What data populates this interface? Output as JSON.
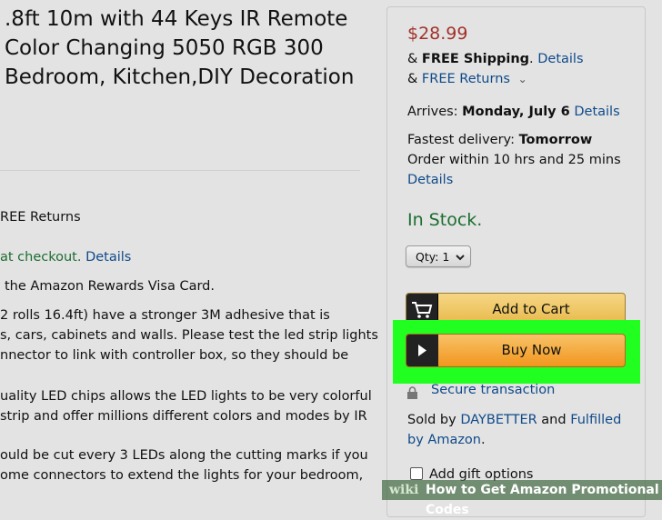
{
  "product": {
    "title_lines": [
      ".8ft 10m with 44 Keys IR Remote",
      "Color Changing 5050 RGB 300",
      "Bedroom, Kitchen,DIY Decoration"
    ],
    "free_returns": "REE Returns",
    "checkout_prefix": "at checkout.",
    "checkout_link": "Details",
    "rewards_link": "the Amazon Rewards Visa Card.",
    "description_lines": [
      "2 rolls 16.4ft) have a stronger 3M adhesive that is",
      "s, cars, cabinets and walls. Please test the led strip lights",
      "nnector to link with controller box, so they should be",
      "uality LED chips allows the LED lights to be very colorful",
      "strip and offer millions different colors and modes by IR",
      "ould be cut every 3 LEDs along the cutting marks if you",
      "ome connectors to extend the lights for your bedroom,"
    ]
  },
  "buybox": {
    "price": "$28.99",
    "shipping_prefix": "& ",
    "shipping_bold": "FREE Shipping",
    "shipping_suffix": ".",
    "shipping_link": "Details",
    "returns_prefix": "& ",
    "returns_link": "FREE Returns",
    "returns_chevron": "⌄",
    "arrives_label": "Arrives: ",
    "arrives_date": "Monday, July 6",
    "arrives_link": "Details",
    "fastest_label": "Fastest delivery: ",
    "fastest_value": "Tomorrow",
    "order_within": "Order within 10 hrs and 25 mins",
    "fastest_link": "Details",
    "stock": "In Stock.",
    "qty_label": "Qty: 1",
    "add_to_cart": "Add to Cart",
    "buy_now": "Buy Now",
    "secure": "Secure transaction",
    "sold_by_prefix": "Sold by ",
    "seller_link": "DAYBETTER",
    "and_text": " and ",
    "fulfilled_link": "Fulfilled",
    "by_amazon_link": "by Amazon",
    "by_amazon_suffix": ".",
    "gift_label": "Add gift options"
  },
  "watermark": {
    "wiki": "wiki",
    "how": "How to Get Amazon Promotional Codes"
  },
  "colors": {
    "price": "#a2322a",
    "in_stock": "#1c6e30",
    "link": "#0f4a8a",
    "highlight": "#20ff20"
  },
  "icons": [
    "cart-icon",
    "play-icon",
    "lock-icon",
    "chevron-down-icon"
  ]
}
